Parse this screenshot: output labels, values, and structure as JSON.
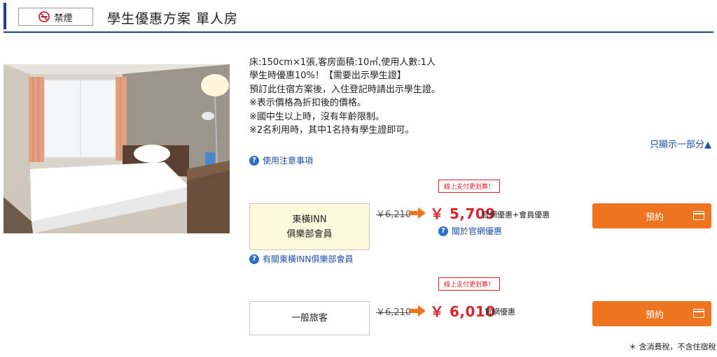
{
  "header": {
    "badge_label": "禁煙",
    "badge_icon": "no-smoking-icon",
    "title": "學生優惠方案 單人房",
    "accent_color": "#1e3f8f"
  },
  "room": {
    "description": [
      "床:150cm×1張,客房面積:10㎡,使用人數:1人",
      "學生時優惠10%！【需要出示學生證】",
      "預訂此住宿方案後，入住登記時請出示學生證。",
      "※表示價格為折扣後的價格。",
      "※國中生以上時，沒有年齡限制。",
      "※2名利用時，其中1名持有學生證即可。"
    ],
    "show_part_label": "只顯示一部分▲",
    "usage_notes_label": "使用注意事項"
  },
  "plans": [
    {
      "online_tag": "線上支付更划算！",
      "member_line1": "東橫INN",
      "member_line2": "俱樂部會員",
      "old_price": "￥6,210",
      "new_price": "￥ 5,709",
      "price_note": "官網優惠+會員優惠",
      "official_link": "關於官網優惠",
      "member_link": "有關東橫INN俱樂部會員",
      "reserve_label": "預約"
    },
    {
      "online_tag": "線上支付更划算！",
      "member_line1": "一般旅客",
      "old_price": "￥6,210",
      "new_price": "￥ 6,010",
      "price_note": "官網優惠",
      "reserve_label": "預約"
    }
  ],
  "tax_note": "＊ 含消費稅，不含住宿稅",
  "colors": {
    "price_red": "#d9232e",
    "button_orange": "#ee7420",
    "link_blue": "#1e4fa5",
    "member_bg": "#fdf9dc"
  }
}
